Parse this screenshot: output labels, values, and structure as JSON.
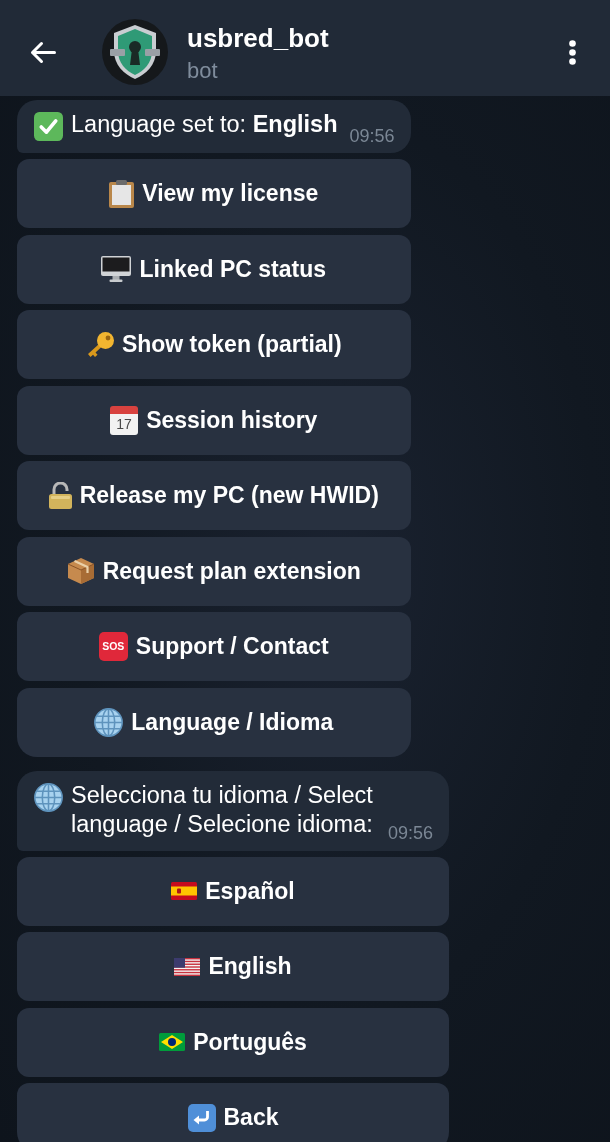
{
  "header": {
    "title": "usbred_bot",
    "subtitle": "bot"
  },
  "messages": [
    {
      "kind": "check",
      "text": "Language set to: **English**",
      "time": "09:56",
      "buttons": [
        {
          "kind": "clipboard",
          "label": "View my license"
        },
        {
          "kind": "monitor",
          "label": "Linked PC status"
        },
        {
          "kind": "key",
          "label": "Show token (partial)"
        },
        {
          "kind": "calendar",
          "icon_text": "17",
          "label": "Session history"
        },
        {
          "kind": "lock",
          "label": "Release my PC (new HWID)"
        },
        {
          "kind": "package",
          "label": "Request plan extension"
        },
        {
          "kind": "sos",
          "icon_text": "SOS",
          "label": "Support / Contact"
        },
        {
          "kind": "globe",
          "label": "Language / Idioma"
        }
      ]
    },
    {
      "kind": "globe",
      "text": "Selecciona tu idioma / Select language / Selecione idioma:",
      "time": "09:56",
      "buttons": [
        {
          "kind": "flag-spain",
          "label": "Español"
        },
        {
          "kind": "flag-us",
          "label": "English"
        },
        {
          "kind": "flag-brazil",
          "label": "Português"
        },
        {
          "kind": "return",
          "label": "Back"
        }
      ]
    }
  ]
}
